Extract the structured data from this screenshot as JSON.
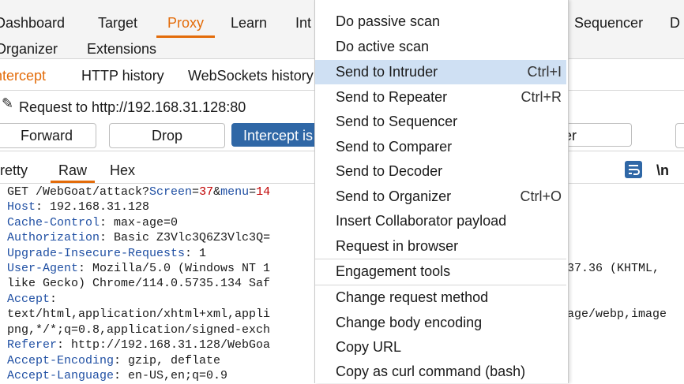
{
  "top_tabs": [
    "Dashboard",
    "Target",
    "Proxy",
    "Learn",
    "Int",
    "Sequencer",
    "D",
    "Organizer",
    "Extensions"
  ],
  "sub_tabs": [
    "Intercept",
    "HTTP history",
    "WebSockets history"
  ],
  "request_line": "Request to http://192.168.31.128:80",
  "buttons": {
    "forward": "Forward",
    "drop": "Drop",
    "intercept": "Intercept is",
    "partial": "er"
  },
  "view_tabs": [
    "Pretty",
    "Raw",
    "Hex"
  ],
  "newline_toggle": "\\n",
  "request": {
    "get_prefix": "GET /WebGoat/attack?",
    "p1_name": "Screen",
    "p1_eq": "=",
    "p1_value": "37",
    "amp": "&",
    "p2_name": "menu",
    "p2_eq": "=",
    "p2_value": "14",
    "lines": [
      {
        "name": "Host",
        "value": ": 192.168.31.128"
      },
      {
        "name": "Cache-Control",
        "value": ": max-age=0"
      },
      {
        "name": "Authorization",
        "value": ": Basic Z3Vlc3Q6Z3Vlc3Q="
      },
      {
        "name": "Upgrade-Insecure-Requests",
        "value": ": 1"
      },
      {
        "name": "User-Agent",
        "value": ": Mozilla/5.0 (Windows NT 1"
      }
    ],
    "ua_right": "37.36 (KHTML,",
    "ua_cont": "like Gecko) Chrome/114.0.5735.134 Saf",
    "accept_name": "Accept",
    "accept_colon": ":",
    "accept_line1": "text/html,application/xhtml+xml,appli",
    "accept_line1_right": "age/webp,image",
    "accept_line2": "png,*/*;q=0.8,application/signed-exch",
    "referer": {
      "name": "Referer",
      "value": ": http://192.168.31.128/WebGoa"
    },
    "accept_encoding": {
      "name": "Accept-Encoding",
      "value": ": gzip, deflate"
    },
    "accept_language": {
      "name": "Accept-Language",
      "value": ": en-US,en;q=0.9"
    }
  },
  "context_menu": {
    "items": [
      {
        "label": "Do passive scan",
        "shortcut": ""
      },
      {
        "label": "Do active scan",
        "shortcut": ""
      },
      {
        "label": "Send to Intruder",
        "shortcut": "Ctrl+I"
      },
      {
        "label": "Send to Repeater",
        "shortcut": "Ctrl+R"
      },
      {
        "label": "Send to Sequencer",
        "shortcut": ""
      },
      {
        "label": "Send to Comparer",
        "shortcut": ""
      },
      {
        "label": "Send to Decoder",
        "shortcut": ""
      },
      {
        "label": "Send to Organizer",
        "shortcut": "Ctrl+O"
      },
      {
        "label": "Insert Collaborator payload",
        "shortcut": ""
      },
      {
        "label": "Request in browser",
        "shortcut": ""
      },
      {
        "label": "Engagement tools",
        "shortcut": ""
      },
      {
        "label": "Change request method",
        "shortcut": ""
      },
      {
        "label": "Change body encoding",
        "shortcut": ""
      },
      {
        "label": "Copy URL",
        "shortcut": ""
      },
      {
        "label": "Copy as curl command (bash)",
        "shortcut": ""
      }
    ],
    "highlighted": "Send to Intruder"
  },
  "colors": {
    "accent": "#e36c0a",
    "primary_button": "#2f67a6",
    "menu_highlight": "#cfe0f3",
    "header_name": "#1f4fa3",
    "param_value": "#c00000"
  }
}
